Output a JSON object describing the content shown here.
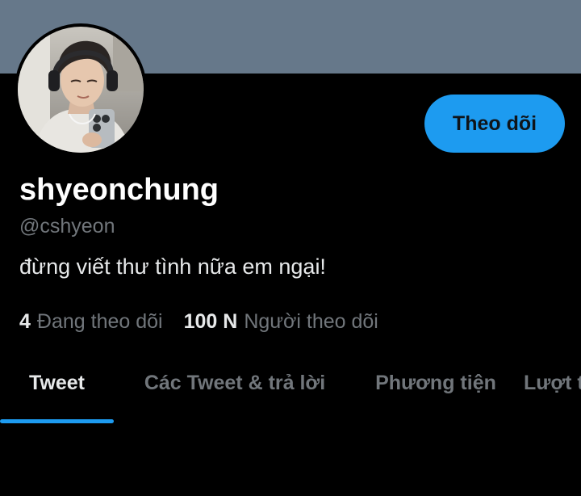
{
  "profile": {
    "display_name": "shyeonchung",
    "handle": "@cshyeon",
    "bio": "đừng viết thư tình nữa em ngại!",
    "follow_label": "Theo dõi",
    "banner_color": "#66788a",
    "avatar_icon": "profile-photo"
  },
  "stats": {
    "following_count": "4",
    "following_label": "Đang theo dõi",
    "followers_count": "100 N",
    "followers_label": "Người theo dõi"
  },
  "tabs": [
    {
      "label": "Tweet",
      "active": true
    },
    {
      "label": "Các Tweet & trả lời",
      "active": false
    },
    {
      "label": "Phương tiện",
      "active": false
    },
    {
      "label": "Lượt thích",
      "active": false
    }
  ],
  "colors": {
    "accent": "#1d9bf0",
    "background": "#000000",
    "secondary_text": "#71767b"
  }
}
